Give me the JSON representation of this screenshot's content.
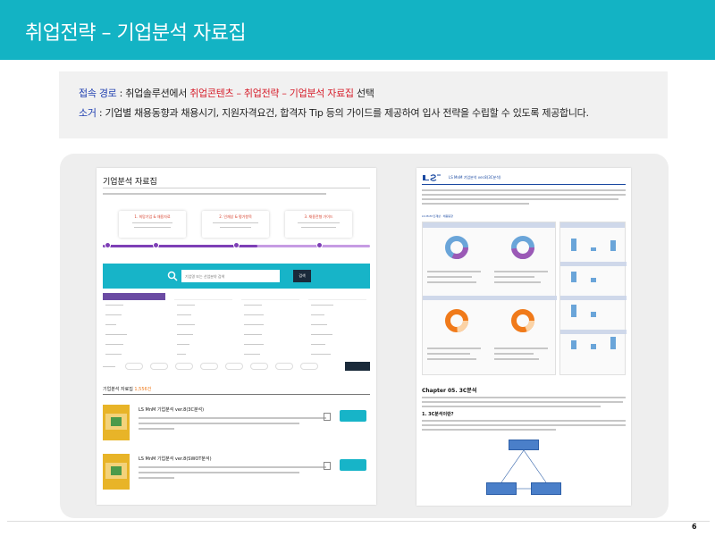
{
  "header": {
    "title": "취업전략 – 기업분석 자료집"
  },
  "info": {
    "path_label": "접속 경로",
    "path_sep": " : ",
    "path_prefix": "취업솔루션에서 ",
    "path_highlight": "취업콘텐츠 – 취업전략 – 기업분석 자료집",
    "path_suffix": " 선택",
    "summary_label": "소거",
    "summary_sep": " : ",
    "summary_text": "기업별 채용동향과 채용시기, 지원자격요건, 합격자 Tip 등의 가이드를 제공하여 입사 전략을 수립할 수 있도록 제공합니다."
  },
  "left_shot": {
    "title": "기업분석 자료집",
    "steps": [
      {
        "label": "1. 희망기업 & 채용자료"
      },
      {
        "label": "2. 인재상 & 평가항목"
      },
      {
        "label": "3. 채용전형 가이드"
      }
    ],
    "search_placeholder": "기업명 또는 산업분야 검색",
    "search_button": "검색",
    "count_prefix": "기업분석 자료집",
    "count_value": "1,556건",
    "results": [
      {
        "title": "LS MnM 기업분석 ver.8(3C분석)"
      },
      {
        "title": "LS MnM 기업분석 ver.8(SWOT분석)"
      }
    ]
  },
  "right_shot": {
    "header_text": "LS MnM 기업분석 ver.8(3C분석)",
    "section_label": "LS MnM 인재상 · 채용동향",
    "chapter": "Chapter 05. 3C분석",
    "subheading": "1. 3C분석이란?"
  },
  "footer": {
    "page_number": "6"
  },
  "colors": {
    "teal": "#13b3c4",
    "red": "#d61f2c",
    "blue_label": "#1f3fb0",
    "purple": "#7e3fb6",
    "orange": "#f07a1a"
  }
}
